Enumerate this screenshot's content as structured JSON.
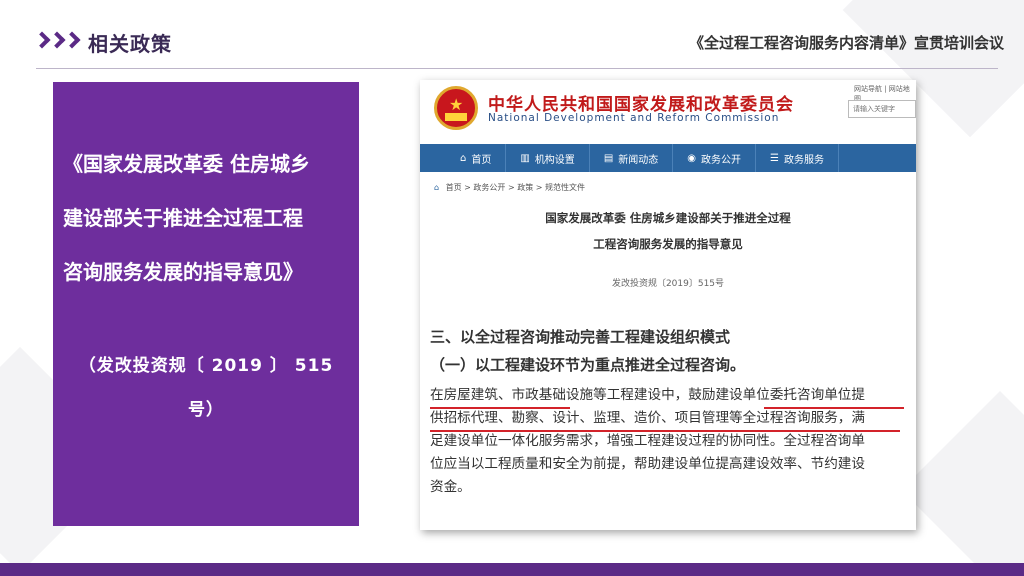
{
  "header": {
    "section_title": "相关政策",
    "meeting_title": "《全过程工程咨询服务内容清单》宣贯培训会议"
  },
  "left_panel": {
    "title_lines": [
      "《国家发展改革委  住房城乡",
      "建设部关于推进全过程工程",
      "咨询服务发展的指导意见》"
    ],
    "number_lines": [
      "（发改投资规〔 2019 〕 515",
      "号）"
    ],
    "background_color": "#6e2e9d"
  },
  "website": {
    "name_cn": "中华人民共和国国家发展和改革委员会",
    "name_en": "National Development and Reform Commission",
    "top_links": "网站导航 | 网站地图",
    "search_placeholder": "请输入关键字",
    "nav": [
      {
        "icon": "home-icon",
        "label": "首页"
      },
      {
        "icon": "building-icon",
        "label": "机构设置"
      },
      {
        "icon": "news-icon",
        "label": "新闻动态"
      },
      {
        "icon": "eye-icon",
        "label": "政务公开"
      },
      {
        "icon": "list-icon",
        "label": "政务服务"
      }
    ],
    "breadcrumb": "首页 > 政务公开 > 政策 > 规范性文件",
    "article_title_line1": "国家发展改革委 住房城乡建设部关于推进全过程",
    "article_title_line2": "工程咨询服务发展的指导意见",
    "article_number": "发改投资规〔2019〕515号",
    "section_heading": "三、以全过程咨询推动完善工程建设组织模式",
    "sub_heading": "（一）以工程建设环节为重点推进全过程咨询。",
    "paragraph_lines": [
      "在房屋建筑、市政基础设施等工程建设中，鼓励建设单位委托咨询单位提",
      "供招标代理、勘察、设计、监理、造价、项目管理等全过程咨询服务，满",
      "足建设单位一体化服务需求，增强工程建设过程的协同性。全过程咨询单",
      "位应当以工程质量和安全为前提，帮助建设单位提高建设效率、节约建设",
      "资金。"
    ],
    "nav_color": "#2b65a0",
    "highlight_color": "#d3232a"
  }
}
